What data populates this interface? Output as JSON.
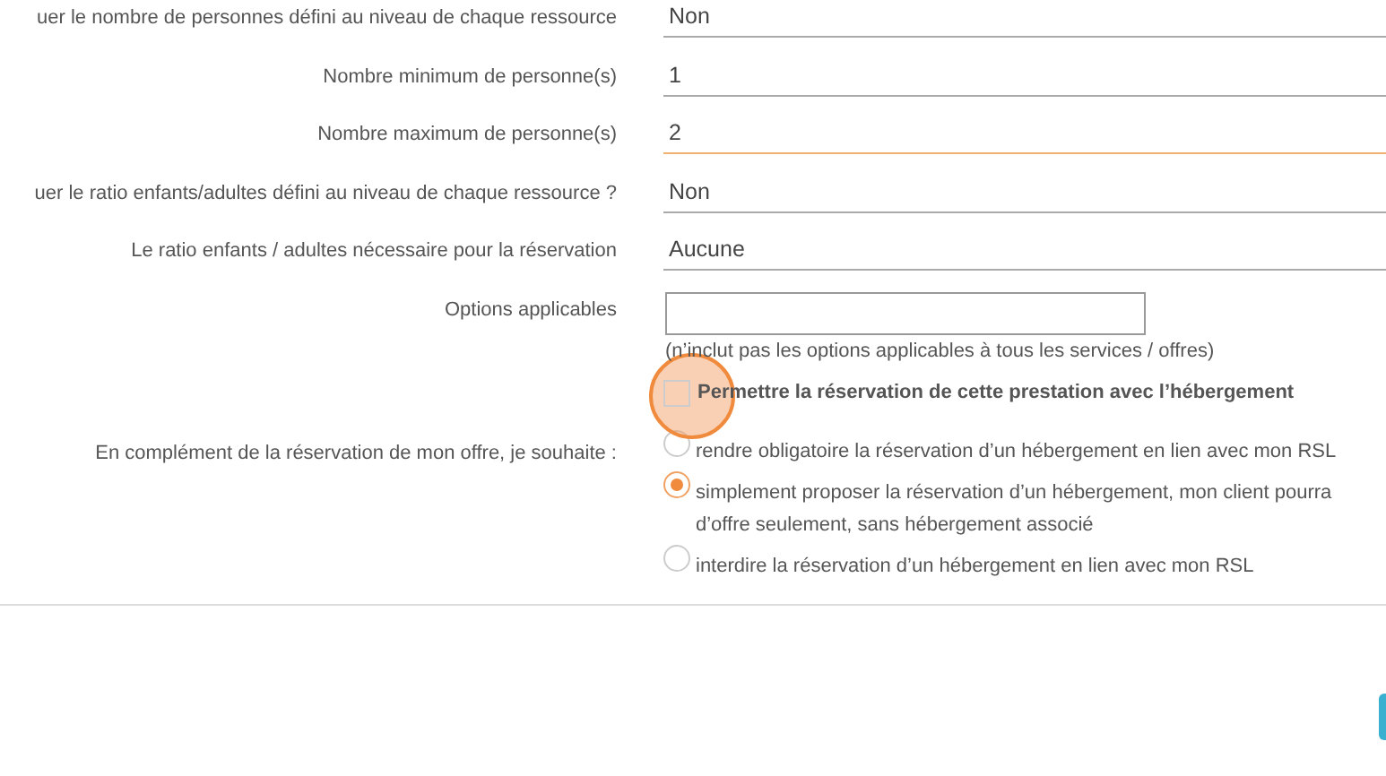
{
  "fields": [
    {
      "label": "uer le nombre de personnes défini au niveau de chaque ressource",
      "value": "Non",
      "focused": false
    },
    {
      "label": "Nombre minimum de personne(s)",
      "value": "1",
      "focused": false
    },
    {
      "label": "Nombre maximum de personne(s)",
      "value": "2",
      "focused": true
    },
    {
      "label": "uer le ratio enfants/adultes défini au niveau de chaque ressource ?",
      "value": "Non",
      "focused": false
    },
    {
      "label": "Le ratio enfants / adultes nécessaire pour la réservation",
      "value": "Aucune",
      "focused": false
    }
  ],
  "options": {
    "label": "Options applicables",
    "help": "(n’inclut pas les options applicables à tous les services / offres)"
  },
  "accommodation": {
    "checkbox_label": "Permettre la réservation de cette prestation avec l’hébergement",
    "checked": false,
    "label": "En complément de la réservation de mon offre, je souhaite :",
    "choices": [
      {
        "lines": [
          "rendre obligatoire la réservation d’un hébergement en lien avec mon RSL"
        ],
        "selected": false
      },
      {
        "lines": [
          "simplement proposer la réservation d’un hébergement, mon client pourra",
          "d’offre seulement, sans hébergement associé"
        ],
        "selected": true
      },
      {
        "lines": [
          "interdire la réservation d’un hébergement en lien avec mon RSL"
        ],
        "selected": false
      }
    ]
  }
}
